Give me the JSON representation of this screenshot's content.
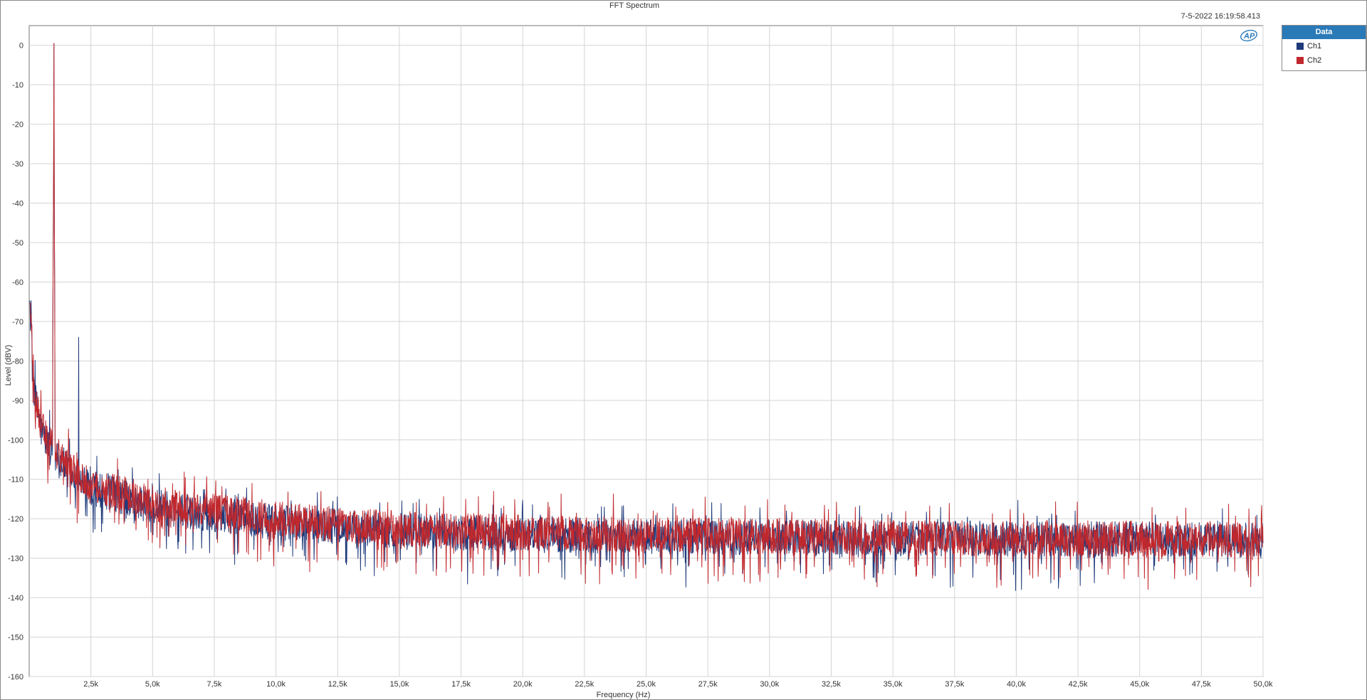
{
  "window": {
    "timestamp": "7-5-2022 16:19:58.413"
  },
  "legend": {
    "title": "Data",
    "items": [
      {
        "label": "Ch1",
        "color": "#1f3a7a"
      },
      {
        "label": "Ch2",
        "color": "#c0282d"
      }
    ]
  },
  "logo": {
    "icon": "ap-logo-icon",
    "text": "AP",
    "color": "#2a7ab8"
  },
  "chart_data": {
    "type": "line",
    "title": "FFT Spectrum",
    "xlabel": "Frequency (Hz)",
    "ylabel": "Level (dBV)",
    "xlim": [
      20,
      50000
    ],
    "ylim": [
      -160,
      5
    ],
    "grid": true,
    "legend_position": "right",
    "x_ticks": [
      2500,
      5000,
      7500,
      10000,
      12500,
      15000,
      17500,
      20000,
      22500,
      25000,
      27500,
      30000,
      32500,
      35000,
      37500,
      40000,
      42500,
      45000,
      47500,
      50000
    ],
    "x_tick_labels": [
      "2,5k",
      "5,0k",
      "7,5k",
      "10,0k",
      "12,5k",
      "15,0k",
      "17,5k",
      "20,0k",
      "22,5k",
      "25,0k",
      "27,5k",
      "30,0k",
      "32,5k",
      "35,0k",
      "37,5k",
      "40,0k",
      "42,5k",
      "45,0k",
      "47,5k",
      "50,0k"
    ],
    "y_ticks": [
      0,
      -10,
      -20,
      -30,
      -40,
      -50,
      -60,
      -70,
      -80,
      -90,
      -100,
      -110,
      -120,
      -130,
      -140,
      -150,
      -160
    ],
    "y_tick_labels": [
      "0",
      "-10",
      "-20",
      "-30",
      "-40",
      "-50",
      "-60",
      "-70",
      "-80",
      "-90",
      "-100",
      "-110",
      "-120",
      "-130",
      "-140",
      "-150",
      "-160"
    ],
    "series": [
      {
        "name": "Ch1",
        "color": "#1f3a7a",
        "x": [
          20,
          200,
          500,
          1000,
          1500,
          2000,
          2500,
          3500,
          5000,
          7500,
          10000,
          12500,
          15000,
          20000,
          25000,
          30000,
          35000,
          40000,
          45000,
          50000
        ],
        "y": [
          -65,
          -88,
          -98,
          -104,
          -107,
          -110,
          -112,
          -114,
          -117,
          -119,
          -121,
          -122,
          -123,
          -124,
          -124.5,
          -124.8,
          -125,
          -125,
          -125.2,
          -125.5
        ],
        "peaks": [
          {
            "x": 1000,
            "y": 0.5
          },
          {
            "x": 2000,
            "y": -74
          }
        ]
      },
      {
        "name": "Ch2",
        "color": "#c0282d",
        "x": [
          20,
          200,
          500,
          1000,
          1500,
          2000,
          2500,
          3500,
          5000,
          7500,
          10000,
          12500,
          15000,
          20000,
          25000,
          30000,
          35000,
          40000,
          45000,
          50000
        ],
        "y": [
          -64,
          -87,
          -97,
          -103,
          -106,
          -109,
          -111,
          -113,
          -116,
          -118,
          -120,
          -121.5,
          -122.5,
          -123.5,
          -124,
          -124.5,
          -124.8,
          -125,
          -125,
          -125.5
        ],
        "peaks": [
          {
            "x": 1000,
            "y": 0.5
          }
        ]
      }
    ]
  }
}
